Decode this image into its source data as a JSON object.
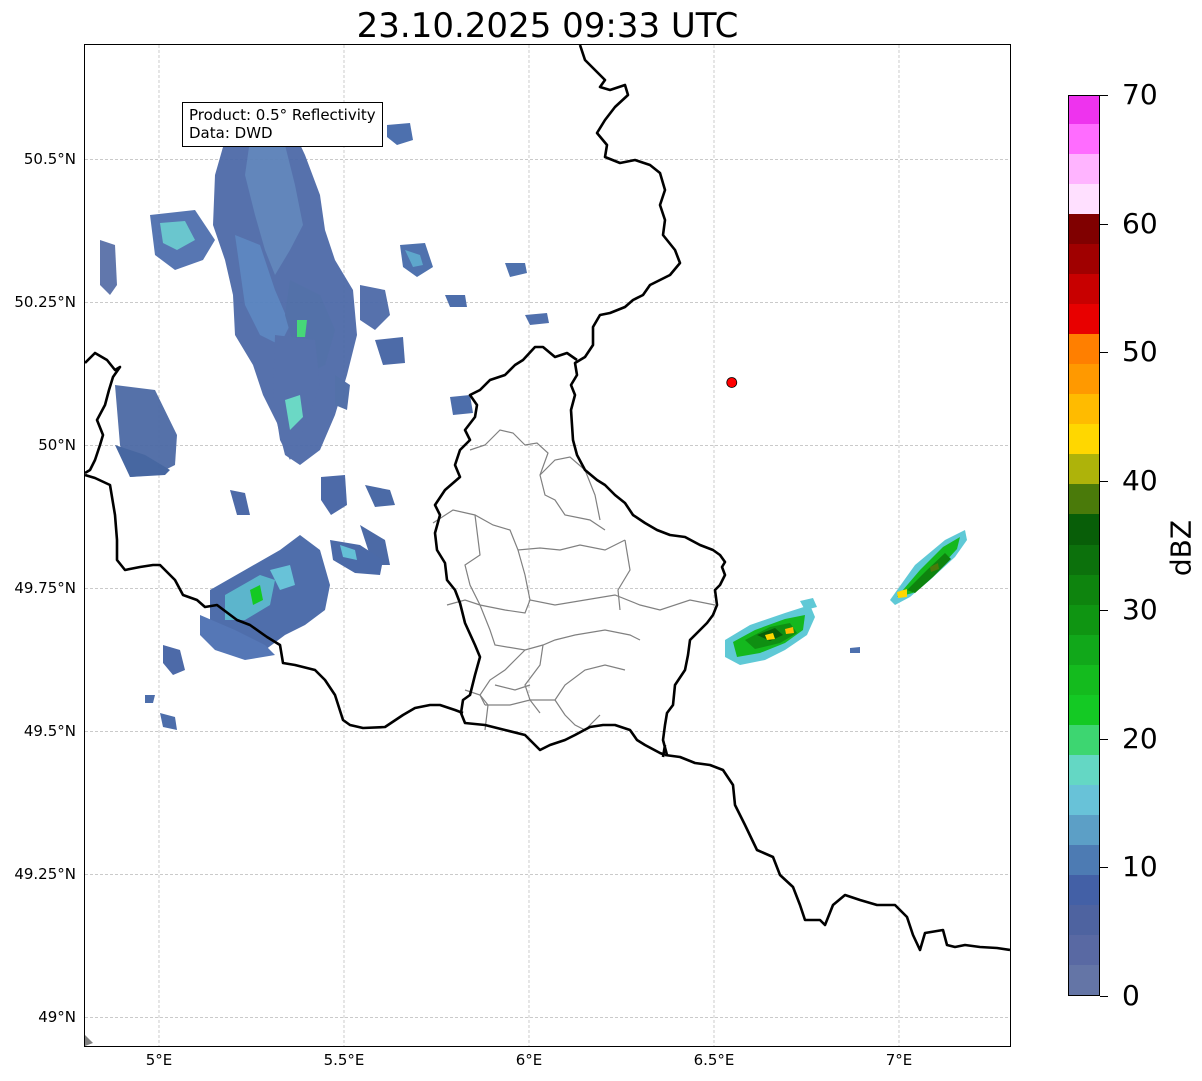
{
  "title": "23.10.2025 09:33 UTC",
  "info_box": {
    "product": "Product: 0.5° Reflectivity",
    "data_source": "Data: DWD"
  },
  "map": {
    "lon_range": [
      4.8,
      7.3
    ],
    "lat_range": [
      48.95,
      50.7
    ],
    "lat_ticks": [
      {
        "value": 50.5,
        "label": "50.5°N"
      },
      {
        "value": 50.25,
        "label": "50.25°N"
      },
      {
        "value": 50.0,
        "label": "50°N"
      },
      {
        "value": 49.75,
        "label": "49.75°N"
      },
      {
        "value": 49.5,
        "label": "49.5°N"
      },
      {
        "value": 49.25,
        "label": "49.25°N"
      },
      {
        "value": 49.0,
        "label": "49°N"
      }
    ],
    "lon_ticks": [
      {
        "value": 5.0,
        "label": "5°E"
      },
      {
        "value": 5.5,
        "label": "5.5°E"
      },
      {
        "value": 6.0,
        "label": "6°E"
      },
      {
        "value": 6.5,
        "label": "6.5°E"
      },
      {
        "value": 7.0,
        "label": "7°E"
      }
    ],
    "grid": true,
    "radar_site": {
      "lon": 6.548,
      "lat": 50.11,
      "color": "#ff0000"
    },
    "border_color": "#000000",
    "admin_color": "#808080"
  },
  "colorbar": {
    "label": "dBZ",
    "min": 0,
    "max": 70,
    "step": 2.5,
    "tick_values": [
      0,
      10,
      20,
      30,
      40,
      50,
      60,
      70
    ],
    "tick_labels": [
      "0",
      "10",
      "20",
      "30",
      "40",
      "50",
      "60",
      "70"
    ],
    "colors": [
      "#6475a6",
      "#5969a3",
      "#4e63a0",
      "#4360a6",
      "#4d7bb3",
      "#5c9fc6",
      "#68c2d8",
      "#64d7c4",
      "#3dd671",
      "#14c924",
      "#14bb1e",
      "#11a81a",
      "#0f9512",
      "#0e840e",
      "#0c710c",
      "#085e08",
      "#4a7a0a",
      "#aeb30a",
      "#ffd700",
      "#ffbb00",
      "#ff9900",
      "#ff7f00",
      "#e80000",
      "#c80000",
      "#a00000",
      "#800000",
      "#ffe0ff",
      "#ffb4ff",
      "#ff6cff",
      "#ee33ee"
    ]
  }
}
